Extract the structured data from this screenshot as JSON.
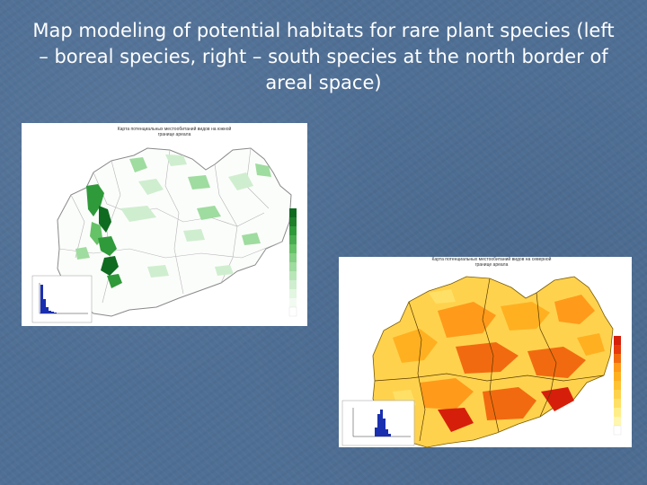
{
  "slide": {
    "title": "Map modeling of potential habitats for rare plant species (left – boreal species, right – south species at the north border of areal space)"
  },
  "maps": [
    {
      "label": "boreal species",
      "title": "Карта потенциальных местообитаний видов на южной границе ареала",
      "color_scale": [
        "#f2fbf2",
        "#cfeecf",
        "#9fdc9f",
        "#66c266",
        "#2f9a3a",
        "#0f6b20"
      ]
    },
    {
      "label": "south species",
      "title": "Карта потенциальных местообитаний видов на северной границе ареала",
      "color_scale": [
        "#fff6b0",
        "#ffe066",
        "#ffc233",
        "#ff9a1a",
        "#f26a0f",
        "#d61f0a"
      ]
    }
  ]
}
